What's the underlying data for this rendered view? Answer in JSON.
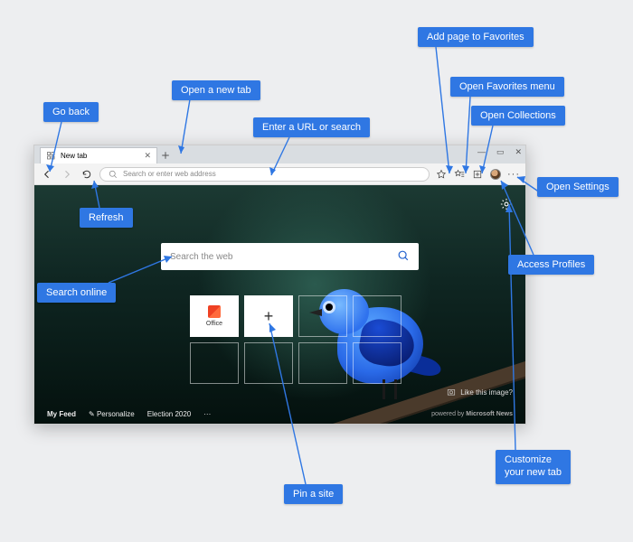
{
  "callouts": {
    "go_back": "Go back",
    "open_new_tab": "Open a new tab",
    "enter_url": "Enter a URL or search",
    "add_favorites": "Add page to Favorites",
    "open_favorites": "Open Favorites menu",
    "open_collections": "Open Collections",
    "open_settings": "Open Settings",
    "access_profiles": "Access Profiles",
    "customize_tab": "Customize your new tab",
    "pin_site": "Pin a site",
    "search_online": "Search online",
    "refresh": "Refresh"
  },
  "tab": {
    "title": "New tab"
  },
  "addressbar": {
    "placeholder": "Search or enter web address"
  },
  "page": {
    "search_placeholder": "Search the web",
    "tiles": {
      "office": "Office"
    },
    "like_image": "Like this image?",
    "feed": {
      "my_feed": "My Feed",
      "personalize": "Personalize",
      "topic": "Election 2020",
      "more": "···",
      "powered_prefix": "powered by",
      "powered_brand": "Microsoft News"
    }
  }
}
